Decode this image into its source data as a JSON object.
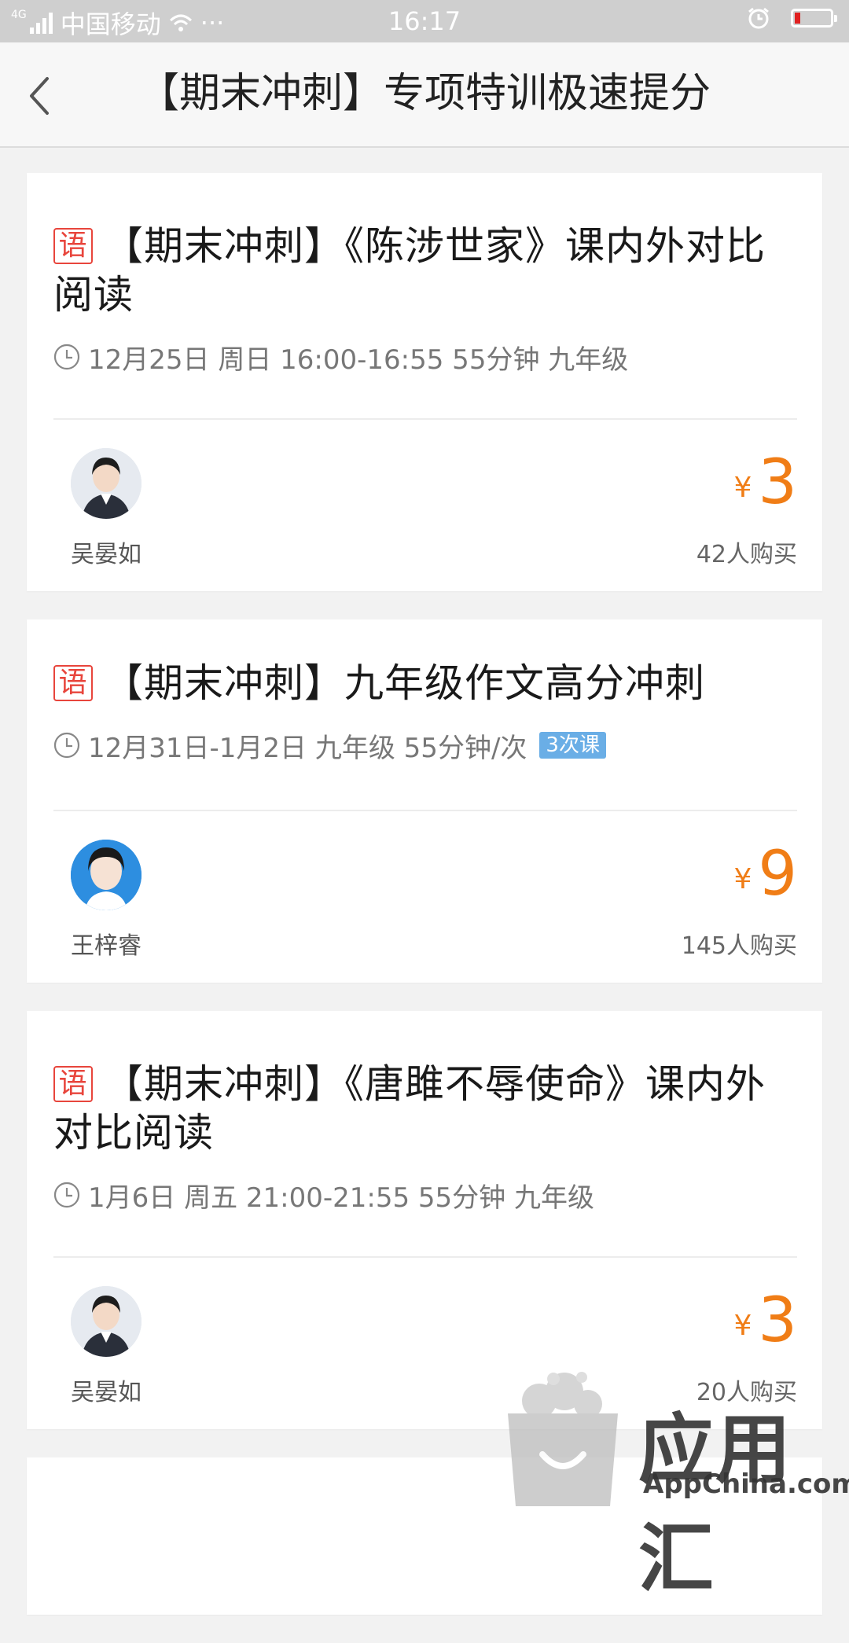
{
  "status_bar": {
    "network": "4G",
    "carrier": "中国移动",
    "more": "···",
    "time": "16:17",
    "battery_level": 0.15
  },
  "navbar": {
    "title": "【期末冲刺】专项特训极速提分",
    "back_icon": "chevron-left-icon"
  },
  "courses": [
    {
      "subject": "语",
      "title": "【期末冲刺】《陈涉世家》课内外对比阅读",
      "meta": "12月25日 周日 16:00-16:55 55分钟 九年级",
      "badge": "",
      "teacher": "吴晏如",
      "currency": "¥",
      "price": "3",
      "buyers": "42人购买"
    },
    {
      "subject": "语",
      "title": "【期末冲刺】九年级作文高分冲刺",
      "meta": "12月31日-1月2日 九年级 55分钟/次",
      "badge": "3次课",
      "teacher": "王梓睿",
      "currency": "¥",
      "price": "9",
      "buyers": "145人购买"
    },
    {
      "subject": "语",
      "title": "【期末冲刺】《唐雎不辱使命》课内外对比阅读",
      "meta": "1月6日 周五 21:00-21:55 55分钟 九年级",
      "badge": "",
      "teacher": "吴晏如",
      "currency": "¥",
      "price": "3",
      "buyers": "20人购买"
    }
  ],
  "watermark": {
    "brand": "应用汇",
    "domain": "AppChina.com"
  },
  "colors": {
    "accent_price": "#f07d16",
    "subject_tag": "#e8453c",
    "badge": "#6aaee6"
  }
}
